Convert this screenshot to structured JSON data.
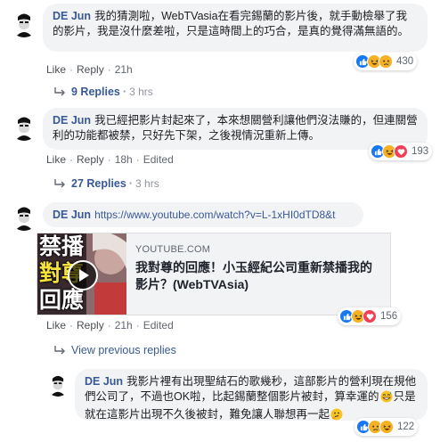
{
  "comments": [
    {
      "author": "DE Jun",
      "text": "我的猜測啦，WebTVasia在看完錫蘭的影片後，就手動檢舉了我的影片，我是沒什麼差啦，只是這時間上的巧合，是真的覺得滿無語的。",
      "like": "Like",
      "reply": "Reply",
      "time": "21h",
      "reaction_count": "430",
      "replies": "9 Replies",
      "replies_time": "3 hrs"
    },
    {
      "author": "DE Jun",
      "text": "我已經把影片封起來了，本來想關營利讓他們沒法賺的，但連關營利的功能都被禁，只好先下架，之後視情況重新上傳。",
      "like": "Like",
      "reply": "Reply",
      "time": "18h",
      "edited": "Edited",
      "reaction_count": "193",
      "replies": "27 Replies",
      "replies_time": "3 hrs"
    },
    {
      "author": "DE Jun",
      "link": "https://www.youtube.com/watch?v=L-1xHI0dTD8&t",
      "card": {
        "domain": "YOUTUBE.COM",
        "title": "我對尊的回應！小玉經紀公司重新禁播我的影片？(WebTVAsia)",
        "thumb_text": [
          "禁播",
          "對尊",
          "回應"
        ]
      },
      "like": "Like",
      "reply": "Reply",
      "time": "21h",
      "edited": "Edited",
      "reaction_count": "156",
      "view_previous": "View previous replies"
    },
    {
      "author": "DE Jun",
      "text_a": "我影片裡有出現聖結石的歌幾秒，這部影片的營利現在規他們公司了，不過也OK啦，比起錫蘭整個影片被封，算幸運的",
      "text_b": "只是就在這影片出現不久後被封，難免讓人聯想再一起",
      "reaction_count": "122"
    }
  ],
  "colors": {
    "link": "#385898",
    "bubble": "#f2f3f5",
    "like": "#1877f2",
    "haha": "#f7b125",
    "love": "#f33e58"
  }
}
